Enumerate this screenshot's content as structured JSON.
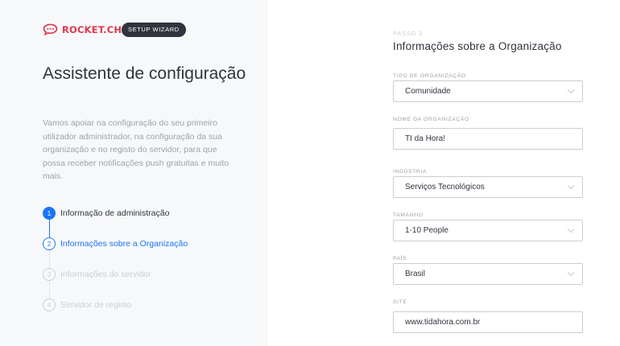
{
  "brand": {
    "name": "ROCKET.CHAT",
    "badge": "SETUP WIZARD",
    "accent": "#e0364b"
  },
  "sidebar": {
    "title": "Assistente de configuração",
    "description": "Vamos apoiar na configuração do seu primeiro utilizador administrador, na configuração da sua organização e no registo do servidor, para que possa receber notificações push gratuitas e muito mais.",
    "steps": [
      {
        "number": "1",
        "label": "Informação de administração",
        "state": "completed"
      },
      {
        "number": "2",
        "label": "Informações sobre a Organização",
        "state": "active"
      },
      {
        "number": "3",
        "label": "Informações do servidor",
        "state": "pending"
      },
      {
        "number": "4",
        "label": "Servidor de registo",
        "state": "pending"
      }
    ]
  },
  "form": {
    "step_caption": "PASSO 2",
    "title": "Informações sobre a Organização",
    "fields": {
      "org_type": {
        "label": "TIPO DE ORGANIZAÇÃO",
        "value": "Comunidade"
      },
      "org_name": {
        "label": "NOME DA ORGANIZAÇÃO",
        "value": "TI da Hora!"
      },
      "industry": {
        "label": "INDÚSTRIA",
        "value": "Serviços Tecnológicos"
      },
      "size": {
        "label": "TAMANHO",
        "value": "1-10 People"
      },
      "country": {
        "label": "PAÍS",
        "value": "Brasil"
      },
      "site": {
        "label": "SITE",
        "value": "www.tidahora.com.br"
      }
    }
  },
  "colors": {
    "primary": "#1d74f5",
    "text": "#2f343d",
    "muted": "#9ea2a8",
    "disabled": "#cbced1"
  }
}
